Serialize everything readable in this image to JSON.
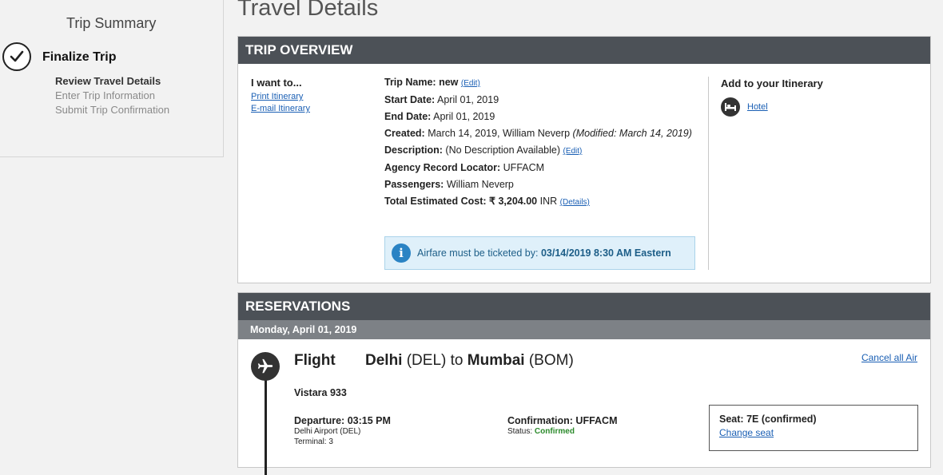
{
  "sidebar": {
    "summary_title": "Trip Summary",
    "step_title": "Finalize Trip",
    "substeps": [
      "Review Travel Details",
      "Enter Trip Information",
      "Submit Trip Confirmation"
    ]
  },
  "page_title": "Travel Details",
  "overview": {
    "header": "TRIP OVERVIEW",
    "actions_label": "I want to...",
    "actions": [
      "Print Itinerary",
      "E-mail Itinerary"
    ],
    "trip_name_label": "Trip Name:",
    "trip_name": "new",
    "edit_label": "(Edit)",
    "start_label": "Start Date:",
    "start_date": "April 01, 2019",
    "end_label": "End Date:",
    "end_date": "April 01, 2019",
    "created_label": "Created:",
    "created": "March 14, 2019, William Neverp",
    "modified": "(Modified: March 14, 2019)",
    "description_label": "Description:",
    "description": "(No Description Available)",
    "locator_label": "Agency Record Locator:",
    "locator": "UFFACM",
    "passengers_label": "Passengers:",
    "passengers": "William Neverp",
    "cost_label": "Total Estimated Cost:",
    "cost_amount": "₹ 3,204.00",
    "cost_currency": "INR",
    "details_link": "(Details)",
    "notice_prefix": "Airfare must be ticketed by:",
    "notice_deadline": "03/14/2019 8:30 AM Eastern",
    "add_title": "Add to your Itinerary",
    "hotel_link": "Hotel"
  },
  "reservations": {
    "header": "RESERVATIONS",
    "date": "Monday, April 01, 2019",
    "type": "Flight",
    "from_city": "Delhi",
    "from_code": "(DEL)",
    "to_word": "to",
    "to_city": "Mumbai",
    "to_code": "(BOM)",
    "cancel_link": "Cancel all Air",
    "flight_name": "Vistara 933",
    "departure_label": "Departure:",
    "departure_time": "03:15 PM",
    "departure_airport": "Delhi Airport (DEL)",
    "terminal": "Terminal: 3",
    "confirmation_label": "Confirmation:",
    "confirmation_code": "UFFACM",
    "status_label": "Status:",
    "status_value": "Confirmed",
    "seat_label": "Seat:",
    "seat_value": "7E (confirmed)",
    "change_seat": "Change seat"
  }
}
